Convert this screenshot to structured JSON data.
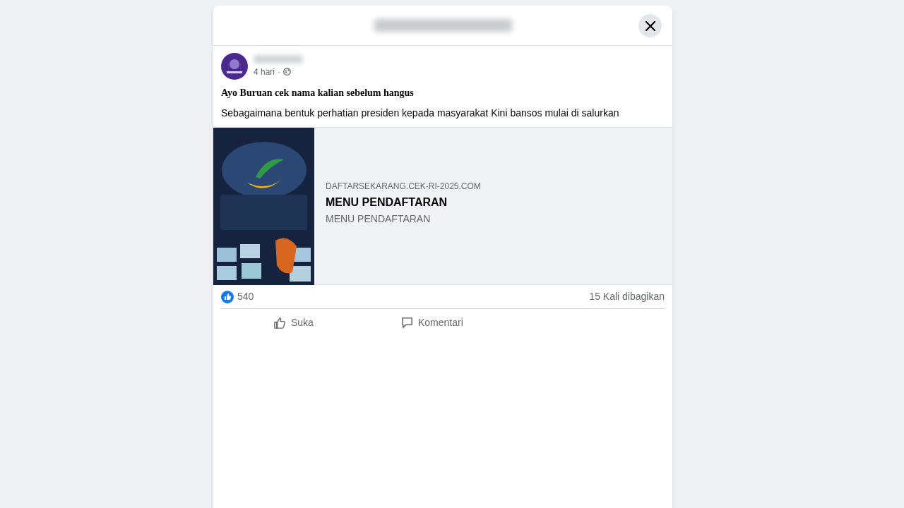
{
  "post": {
    "time": "4 hari",
    "separator": "·",
    "headline": "Ayo Buruan cek nama kalian sebelum hangus",
    "text": "Sebagaimana bentuk perhatian presiden kepada masyarakat Kini bansos mulai di salurkan"
  },
  "link_preview": {
    "domain": "DAFTARSEKARANG.CEK-RI-2025.COM",
    "title": "MENU PENDAFTARAN",
    "description": "MENU PENDAFTARAN"
  },
  "stats": {
    "reactions": "540",
    "shares": "15 Kali dibagikan"
  },
  "actions": [
    {
      "kind": "like",
      "label": "Suka"
    },
    {
      "kind": "comment",
      "label": "Komentari"
    }
  ]
}
